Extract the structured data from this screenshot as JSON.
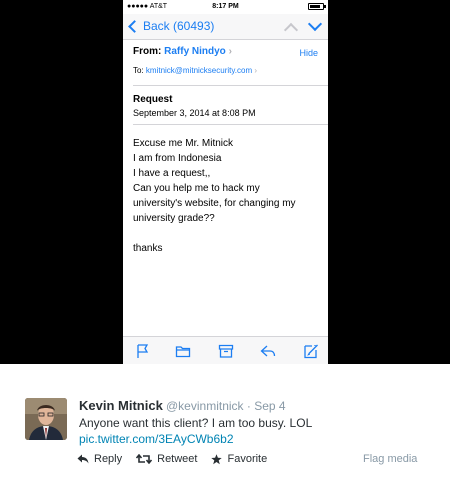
{
  "status_bar": {
    "carrier": "●●●●● AT&T",
    "time": "8:17 PM"
  },
  "nav": {
    "back_label": "Back (60493)"
  },
  "email": {
    "from_label": "From:",
    "sender": "Raffy Nindyo",
    "hide_label": "Hide",
    "to_label": "To:",
    "to_address": "kmitnick@mitnicksecurity.com",
    "subject": "Request",
    "date": "September 3, 2014 at 8:08 PM",
    "body_lines": [
      "Excuse me Mr. Mitnick",
      "I am from Indonesia",
      "I have a request,,",
      "Can you help me to hack my",
      "university's website, for changing my",
      "university grade??",
      "",
      "thanks"
    ]
  },
  "toolbar": {
    "icons": [
      "flag-icon",
      "folder-icon",
      "archive-icon",
      "reply-icon",
      "compose-icon"
    ]
  },
  "tweet": {
    "name": "Kevin Mitnick",
    "handle": "@kevinmitnick · Sep 4",
    "text": "Anyone want this client? I am too busy. LOL",
    "link": "pic.twitter.com/3EAyCWb6b2",
    "reply_label": "Reply",
    "retweet_label": "Retweet",
    "favorite_label": "Favorite",
    "flag_media_label": "Flag media"
  },
  "colors": {
    "ios_blue": "#1c7ef2",
    "twitter_link": "#0084b4",
    "muted": "#8899a6"
  }
}
